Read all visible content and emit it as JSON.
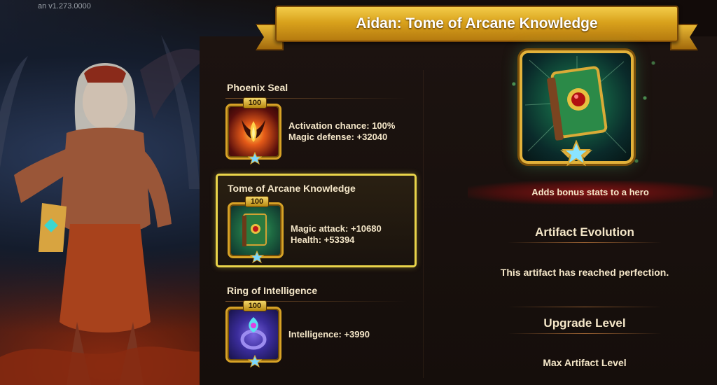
{
  "version": "an v1.273.0000",
  "title": "Aidan: Tome of Arcane Knowledge",
  "artifacts": [
    {
      "name": "Phoenix Seal",
      "level": "100",
      "icon": "phoenix-seal-icon",
      "stats": [
        "Activation chance: 100%",
        "Magic defense: +32040"
      ],
      "selected": false
    },
    {
      "name": "Tome of Arcane Knowledge",
      "level": "100",
      "icon": "tome-icon",
      "stats": [
        "Magic attack: +10680",
        "Health: +53394"
      ],
      "selected": true
    },
    {
      "name": "Ring of Intelligence",
      "level": "100",
      "icon": "ring-icon",
      "stats": [
        "Intelligence: +3990"
      ],
      "selected": false
    }
  ],
  "detail": {
    "icon": "tome-icon",
    "description": "Adds bonus stats to a hero",
    "evolution_title": "Artifact Evolution",
    "evolution_text": "This artifact has reached perfection.",
    "upgrade_title": "Upgrade Level",
    "upgrade_text": "Max Artifact Level"
  },
  "colors": {
    "gold": "#d9a21c",
    "selected_border": "#e9d44a",
    "text": "#f4e6c8",
    "desc_band": "#961414"
  }
}
